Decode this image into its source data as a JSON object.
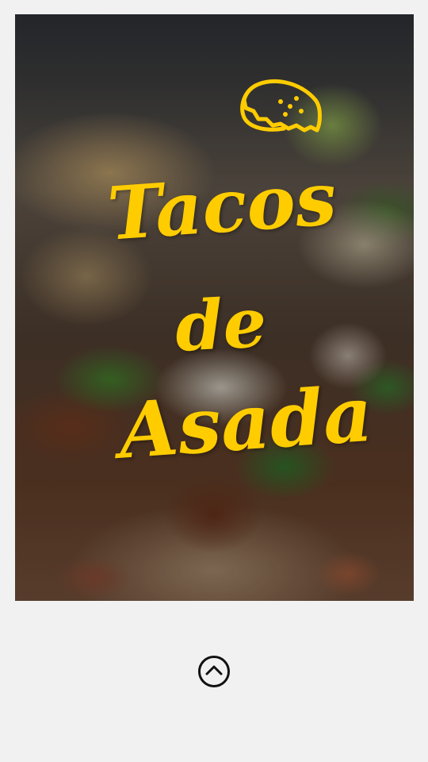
{
  "story": {
    "title_line_1": "Tacos",
    "title_line_2": "de",
    "title_line_3": "Asada"
  },
  "colors": {
    "title": "#ffcc00",
    "page_background": "#f1f1f1",
    "button": "#111111"
  },
  "icons": {
    "header_icon": "taco-icon",
    "scroll_button": "chevron-up-circle-icon"
  }
}
